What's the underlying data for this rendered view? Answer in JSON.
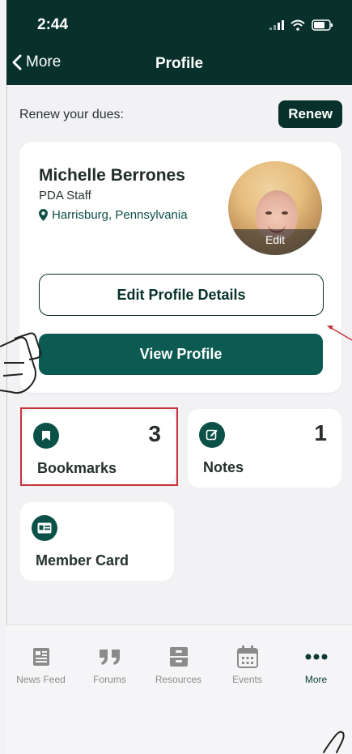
{
  "status_bar": {
    "time": "2:44"
  },
  "nav": {
    "back_label": "More",
    "title": "Profile"
  },
  "renew": {
    "text": "Renew your dues:",
    "button_label": "Renew"
  },
  "profile": {
    "name": "Michelle Berrones",
    "role": "PDA Staff",
    "location": "Harrisburg, Pennsylvania",
    "avatar_edit_label": "Edit",
    "edit_button_label": "Edit Profile Details",
    "view_button_label": "View Profile"
  },
  "tiles": [
    {
      "label": "Bookmarks",
      "count": "3",
      "icon": "bookmark-icon"
    },
    {
      "label": "Notes",
      "count": "1",
      "icon": "edit-note-icon"
    },
    {
      "label": "Member Card",
      "icon": "id-card-icon"
    }
  ],
  "tabbar": {
    "items": [
      {
        "label": "News Feed",
        "icon": "news-feed-icon"
      },
      {
        "label": "Forums",
        "icon": "quote-icon"
      },
      {
        "label": "Resources",
        "icon": "filing-cabinet-icon"
      },
      {
        "label": "Events",
        "icon": "calendar-icon"
      },
      {
        "label": "More",
        "icon": "more-dots-icon"
      }
    ],
    "active": "More"
  },
  "colors": {
    "header": "#07312a",
    "accent": "#0c5b52",
    "highlight": "#c6343a"
  }
}
